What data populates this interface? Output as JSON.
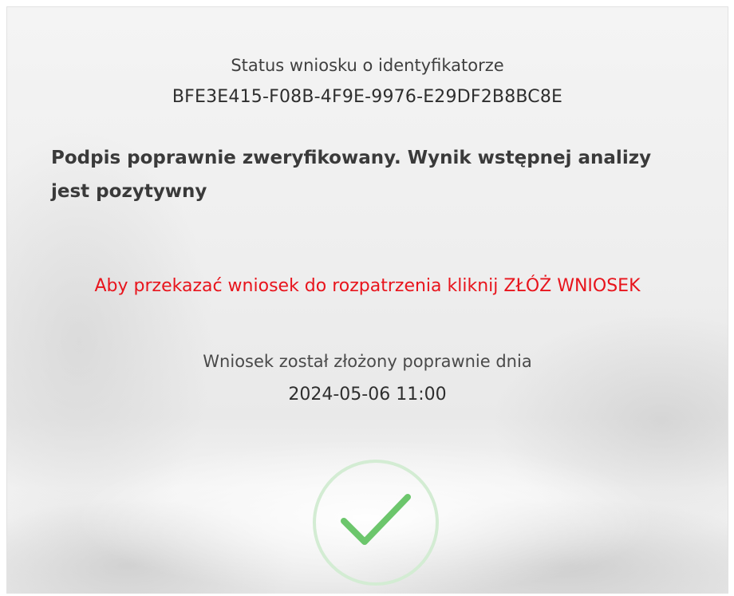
{
  "status": {
    "title": "Status wniosku o identyfikatorze",
    "identifier": "BFE3E415-F08B-4F9E-9976-E29DF2B8BC8E",
    "message": "Podpis poprawnie zweryfikowany. Wynik wstępnej analizy jest pozytywny",
    "instruction": "Aby przekazać wniosek do rozpatrzenia kliknij ZŁÓŻ WNIOSEK",
    "submitted_label": "Wniosek został złożony poprawnie dnia",
    "submitted_date": "2024-05-06 11:00",
    "success_icon": "check-icon"
  },
  "colors": {
    "instruction": "#e8141c",
    "success_ring": "#d3ecd3",
    "success_check": "#6cc66c"
  }
}
